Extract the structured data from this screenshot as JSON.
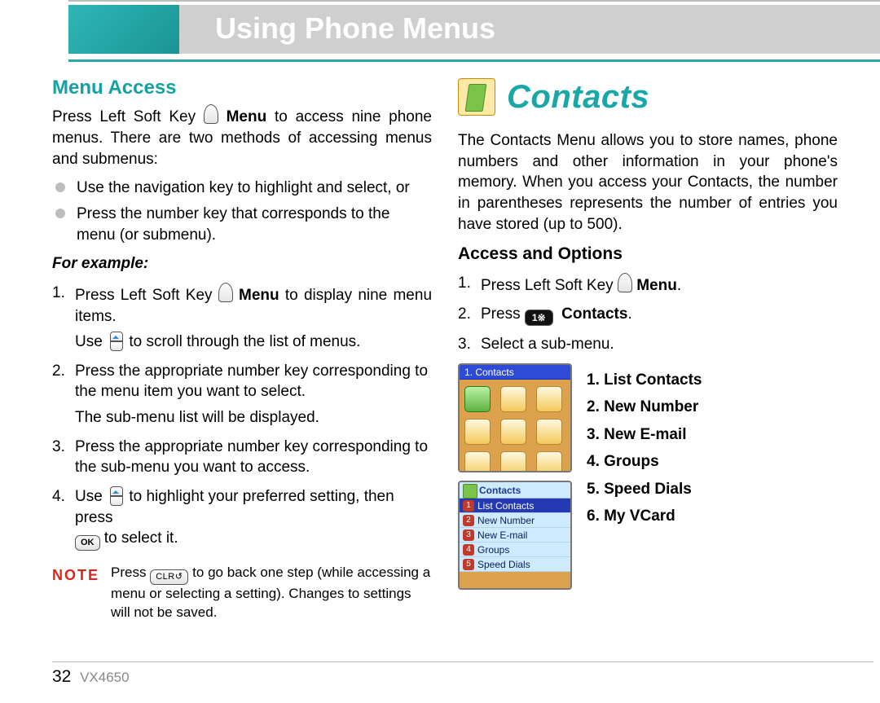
{
  "header": {
    "title": "Using Phone Menus"
  },
  "menu_access": {
    "heading": "Menu Access",
    "intro_1": "Press Left Soft Key ",
    "intro_menu": "Menu",
    "intro_2": " to access nine phone menus. There are two methods of accessing menus and submenus:",
    "bullets": [
      "Use the navigation key to highlight and select, or",
      "Press the number key that corresponds to the menu (or submenu)."
    ],
    "example_label": "For example:",
    "step1a": "Press Left Soft Key ",
    "step1b": "Menu",
    "step1c": " to display nine menu items.",
    "step1_use": "Use ",
    "step1_scroll_after": " to scroll through the list of menus.",
    "step2": "Press the appropriate number key corresponding to the menu item you want to select.",
    "step2b": "The sub-menu list will be displayed.",
    "step3": "Press the appropriate number key corresponding to the sub-menu you want to access.",
    "step4a": "Use ",
    "step4b": " to highlight your preferred setting, then press ",
    "step4c": " to select it.",
    "ok_label": "OK",
    "note_label": "NOTE",
    "note_a": "Press ",
    "note_b": " to go back one step (while accessing a menu or selecting a setting). Changes to settings will not be saved.",
    "clr_label": "CLR↺"
  },
  "contacts": {
    "title": "Contacts",
    "intro": "The Contacts Menu allows you to store names, phone numbers and other information in your phone's memory. When you access your Contacts, the number in parentheses represents the number of entries you have stored (up to 500).",
    "subheading": "Access and Options",
    "step1a": "Press Left Soft Key ",
    "step1b": "Menu",
    "step1c": ".",
    "step2a": "Press ",
    "step2_key": "1※",
    "step2b": "Contacts",
    "step2c": ".",
    "step3": "Select a sub-menu.",
    "screen1_title": "1. Contacts",
    "screen2_title": "Contacts",
    "screen2_rows": [
      "List Contacts",
      "New Number",
      "New E-mail",
      "Groups",
      "Speed Dials"
    ],
    "list": [
      "1. List Contacts",
      "2. New Number",
      "3. New E-mail",
      "4. Groups",
      "5. Speed Dials",
      "6. My VCard"
    ]
  },
  "footer": {
    "page": "32",
    "model": "VX4650"
  }
}
